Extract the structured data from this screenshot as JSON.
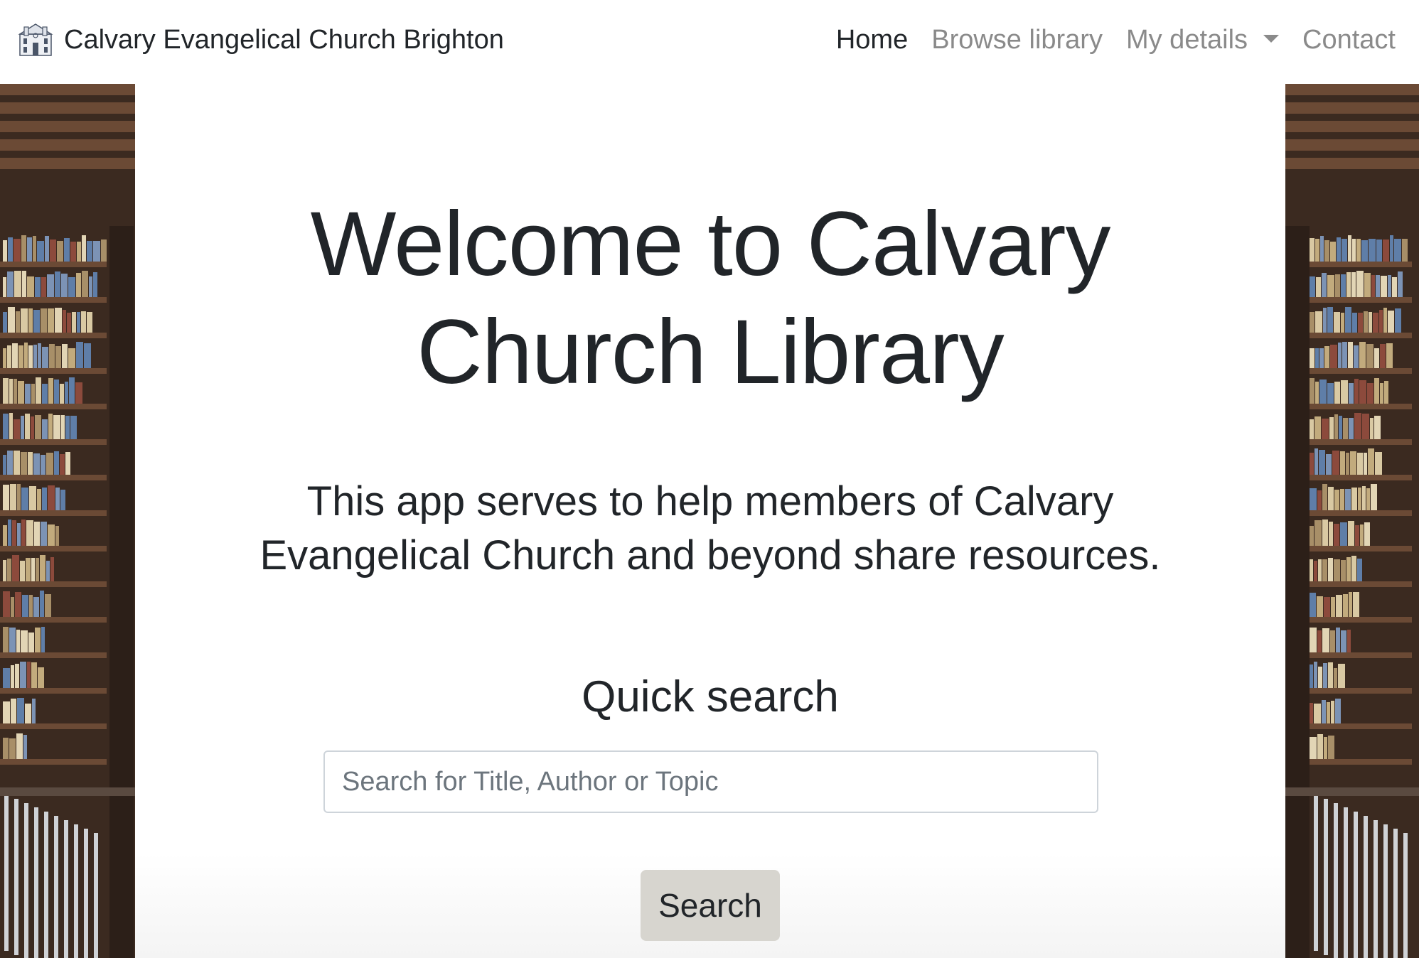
{
  "navbar": {
    "brand_logo_icon": "church-building-icon",
    "brand_name": "Calvary Evangelical Church Brighton",
    "links": {
      "home": "Home",
      "browse": "Browse library",
      "my_details": "My details",
      "contact": "Contact"
    },
    "active_link": "home"
  },
  "main": {
    "title_line1": "Welcome to Calvary",
    "title_line2": "Church Library",
    "subtitle_line1": "This app serves to help members of Calvary",
    "subtitle_line2": "Evangelical Church and beyond share resources.",
    "quick_search_heading": "Quick search",
    "search_placeholder": "Search for Title, Author or Topic",
    "search_value": "",
    "search_button": "Search"
  },
  "background": {
    "image": "library-bookshelves",
    "colors": {
      "wood_dark": "#3b2a20",
      "wood_mid": "#6b4a35",
      "book_cream": "#d9c9a3",
      "book_blue": "#5f7ea8",
      "book_red": "#8c4a3c"
    }
  },
  "colors": {
    "text": "#212529",
    "nav_muted": "#8a8a8a",
    "button_bg": "#d7d5cf",
    "input_border": "#ced4da"
  }
}
